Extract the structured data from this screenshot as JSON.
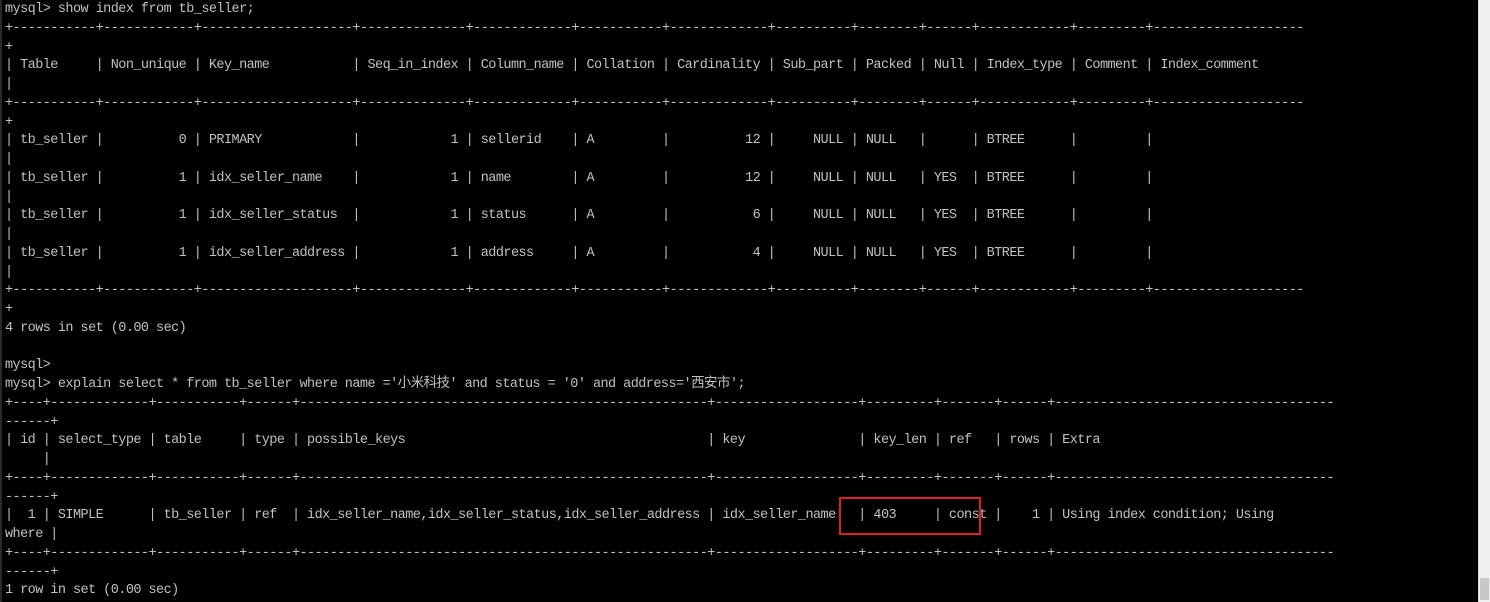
{
  "terminal": {
    "lines": [
      "mysql> show index from tb_seller;",
      "+-----------+------------+--------------------+--------------+-------------+-----------+-------------+----------+--------+------+------------+---------+--------------------",
      "+",
      "| Table     | Non_unique | Key_name           | Seq_in_index | Column_name | Collation | Cardinality | Sub_part | Packed | Null | Index_type | Comment | Index_comment",
      "|",
      "+-----------+------------+--------------------+--------------+-------------+-----------+-------------+----------+--------+------+------------+---------+--------------------",
      "+",
      "| tb_seller |          0 | PRIMARY            |            1 | sellerid    | A         |          12 |     NULL | NULL   |      | BTREE      |         |",
      "|",
      "| tb_seller |          1 | idx_seller_name    |            1 | name        | A         |          12 |     NULL | NULL   | YES  | BTREE      |         |",
      "|",
      "| tb_seller |          1 | idx_seller_status  |            1 | status      | A         |           6 |     NULL | NULL   | YES  | BTREE      |         |",
      "|",
      "| tb_seller |          1 | idx_seller_address |            1 | address     | A         |           4 |     NULL | NULL   | YES  | BTREE      |         |",
      "|",
      "+-----------+------------+--------------------+--------------+-------------+-----------+-------------+----------+--------+------+------------+---------+--------------------",
      "+",
      "4 rows in set (0.00 sec)",
      "",
      "mysql>",
      "mysql> explain select * from tb_seller where name ='小米科技' and status = '0' and address='西安市';",
      "+----+-------------+-----------+------+------------------------------------------------------+-------------------+---------+-------+------+-------------------------------------",
      "------+",
      "| id | select_type | table     | type | possible_keys                                        | key               | key_len | ref   | rows | Extra",
      "     |",
      "+----+-------------+-----------+------+------------------------------------------------------+-------------------+---------+-------+------+-------------------------------------",
      "------+",
      "|  1 | SIMPLE      | tb_seller | ref  | idx_seller_name,idx_seller_status,idx_seller_address | idx_seller_name   | 403     | const |    1 | Using index condition; Using",
      "where |",
      "+----+-------------+-----------+------+------------------------------------------------------+-------------------+---------+-------+------+-------------------------------------",
      "------+",
      "1 row in set (0.00 sec)"
    ]
  },
  "highlight": {
    "text": "idx_seller_name",
    "color": "#e02020"
  },
  "colors": {
    "background": "#000000",
    "text": "#c0c0c0",
    "highlight_border": "#e02020"
  }
}
